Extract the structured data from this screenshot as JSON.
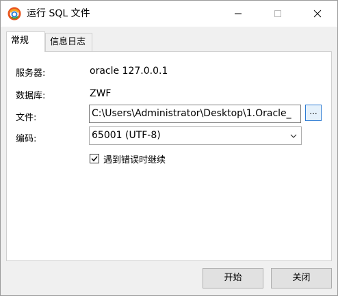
{
  "window": {
    "title": "运行 SQL 文件",
    "icon": "navicat-icon"
  },
  "tabs": [
    {
      "label": "常规",
      "active": true
    },
    {
      "label": "信息日志",
      "active": false
    }
  ],
  "form": {
    "server_label": "服务器:",
    "server_value": "oracle 127.0.0.1",
    "database_label": "数据库:",
    "database_value": "ZWF",
    "file_label": "文件:",
    "file_value": "C:\\Users\\Administrator\\Desktop\\1.Oracle_",
    "browse_label": "...",
    "encoding_label": "编码:",
    "encoding_value": "65001 (UTF-8)",
    "continue_on_error_label": "遇到错误时继续",
    "continue_on_error_checked": true
  },
  "buttons": {
    "start": "开始",
    "close": "关闭"
  },
  "colors": {
    "accent": "#2d7bd3",
    "background": "#f0f0f0"
  }
}
